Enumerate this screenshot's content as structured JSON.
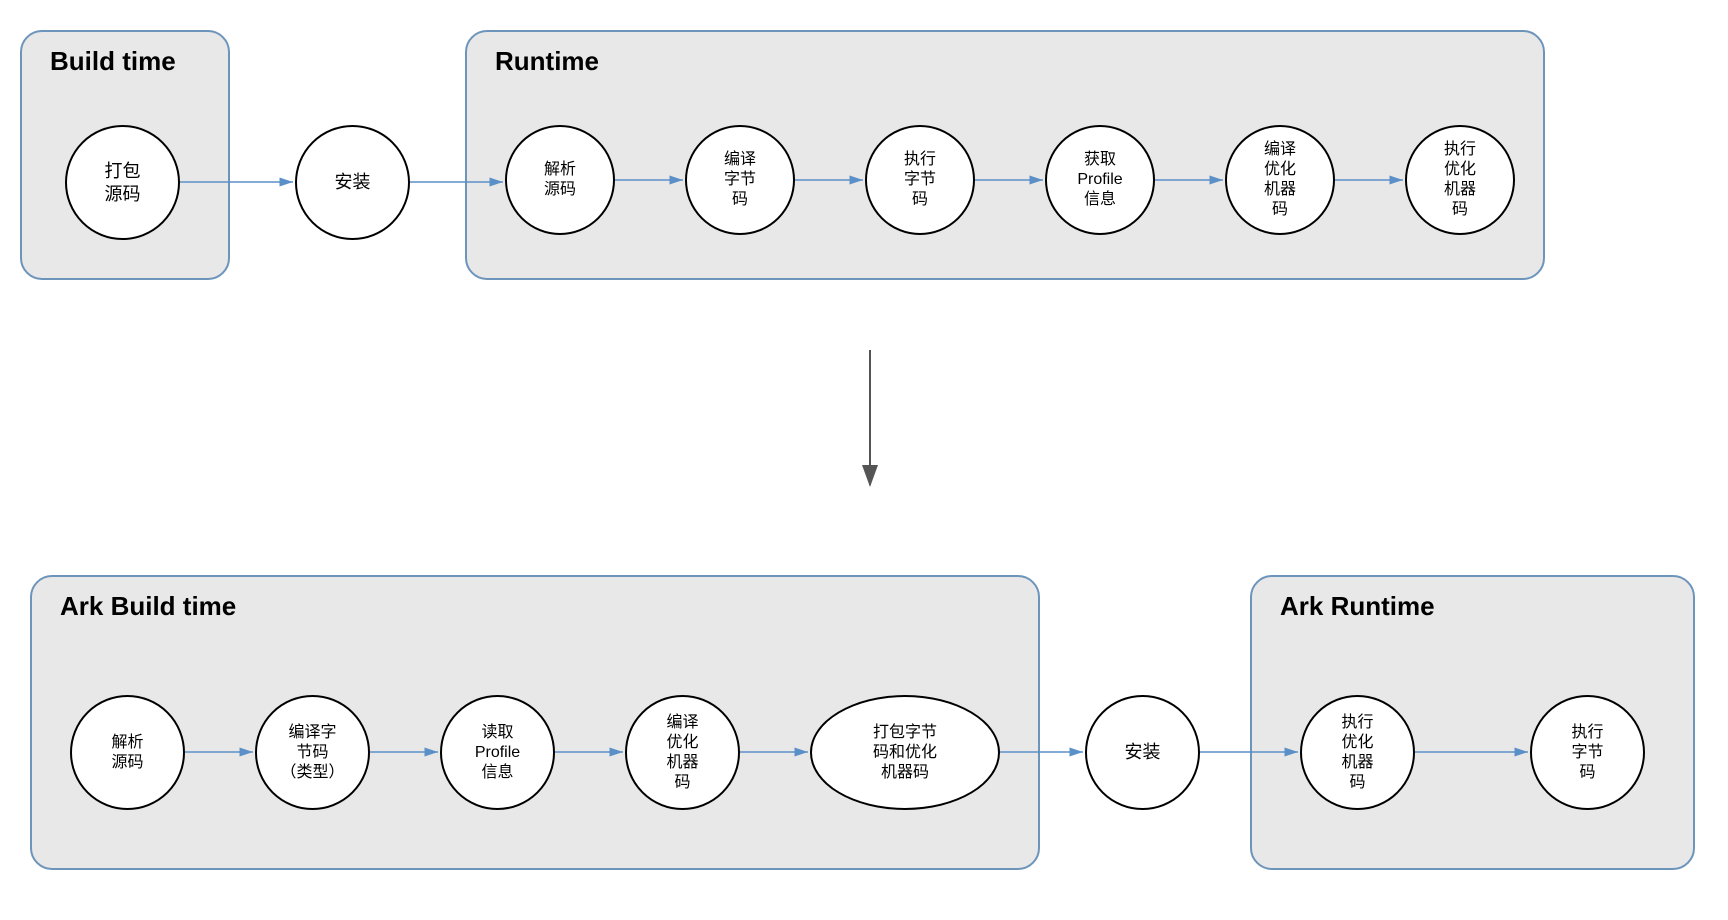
{
  "top": {
    "build_time": {
      "title": "Build time",
      "nodes": {
        "package_source": "打包\n源码"
      }
    },
    "install": {
      "label": "安装"
    },
    "runtime": {
      "title": "Runtime",
      "nodes": {
        "parse_source": "解析\n源码",
        "compile_bytecode": "编译\n字节\n码",
        "execute_bytecode": "执行\n字节\n码",
        "get_profile": "获取\nProfile\n信息",
        "compile_opt_machine": "编译\n优化\n机器\n码",
        "execute_opt_machine": "执行\n优化\n机器\n码"
      }
    }
  },
  "bottom": {
    "ark_build_time": {
      "title": "Ark Build time",
      "nodes": {
        "parse_source": "解析\n源码",
        "compile_bytecode_types": "编译字\n节码\n（类型）",
        "read_profile": "读取\nProfile\n信息",
        "compile_opt_machine": "编译\n优化\n机器\n码",
        "package_bytecode_opt": "打包字节\n码和优化\n机器码"
      }
    },
    "install": {
      "label": "安装"
    },
    "ark_runtime": {
      "title": "Ark Runtime",
      "nodes": {
        "execute_opt_machine": "执行\n优化\n机器\n码",
        "execute_bytecode": "执行\n字节\n码"
      }
    }
  },
  "colors": {
    "group_border": "#6d94bb",
    "group_fill": "#e8e8e8",
    "arrow_blue": "#5b8fc7",
    "arrow_gray": "#555555"
  }
}
